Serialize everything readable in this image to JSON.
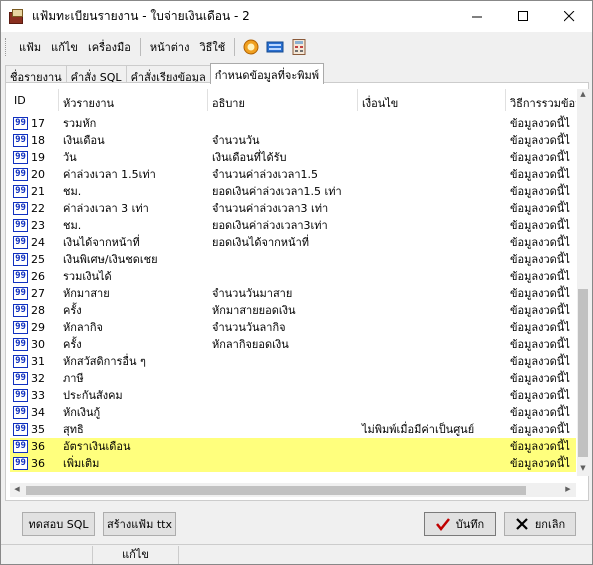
{
  "window": {
    "title": "แฟ้มทะเบียนรายงาน - ใบจ่ายเงินเดือน - 2"
  },
  "menu": {
    "items": [
      "แฟ้ม",
      "แก้ไข",
      "เครื่องมือ",
      "หน้าต่าง",
      "วิธีใช้"
    ]
  },
  "tabs": [
    "ชื่อรายงาน",
    "คำสั่ง SQL",
    "คำสั่งเรียงข้อมูล",
    "กำหนดข้อมูลที่จะพิมพ์"
  ],
  "grid": {
    "columns": [
      "ID",
      "หัวรายงาน",
      "อธิบาย",
      "เงื่อนไข",
      "วิธีการรวมข้อมูล"
    ],
    "rows": [
      {
        "badge": "99",
        "id": "17",
        "title": "รวมหัก",
        "desc": "",
        "cond": "",
        "sum": "ข้อมูลงวดนี้ไ",
        "hl": false
      },
      {
        "badge": "99",
        "id": "18",
        "title": "เงินเดือน",
        "desc": "จำนวนวัน",
        "cond": "",
        "sum": "ข้อมูลงวดนี้ไ",
        "hl": false
      },
      {
        "badge": "99",
        "id": "19",
        "title": "วัน",
        "desc": "เงินเดือนที่ได้รับ",
        "cond": "",
        "sum": "ข้อมูลงวดนี้ไ",
        "hl": false
      },
      {
        "badge": "99",
        "id": "20",
        "title": "ค่าล่วงเวลา 1.5เท่า",
        "desc": "จำนวนค่าล่วงเวลา1.5",
        "cond": "",
        "sum": "ข้อมูลงวดนี้ไ",
        "hl": false
      },
      {
        "badge": "99",
        "id": "21",
        "title": "ชม.",
        "desc": "ยอดเงินค่าล่วงเวลา1.5 เท่า",
        "cond": "",
        "sum": "ข้อมูลงวดนี้ไ",
        "hl": false
      },
      {
        "badge": "99",
        "id": "22",
        "title": "ค่าล่วงเวลา 3 เท่า",
        "desc": "จำนวนค่าล่วงเวลา3 เท่า",
        "cond": "",
        "sum": "ข้อมูลงวดนี้ไ",
        "hl": false
      },
      {
        "badge": "99",
        "id": "23",
        "title": "ชม.",
        "desc": "ยอดเงินค่าล่วงเวลา3เท่า",
        "cond": "",
        "sum": "ข้อมูลงวดนี้ไ",
        "hl": false
      },
      {
        "badge": "99",
        "id": "24",
        "title": "เงินได้จากหน้าที่",
        "desc": "ยอดเงินได้จากหน้าที่",
        "cond": "",
        "sum": "ข้อมูลงวดนี้ไ",
        "hl": false
      },
      {
        "badge": "99",
        "id": "25",
        "title": "เงินพิเศษ/เงินชดเชย",
        "desc": "",
        "cond": "",
        "sum": "ข้อมูลงวดนี้ไ",
        "hl": false
      },
      {
        "badge": "99",
        "id": "26",
        "title": "รวมเงินได้",
        "desc": "",
        "cond": "",
        "sum": "ข้อมูลงวดนี้ไ",
        "hl": false
      },
      {
        "badge": "99",
        "id": "27",
        "title": "หักมาสาย",
        "desc": "จำนวนวันมาสาย",
        "cond": "",
        "sum": "ข้อมูลงวดนี้ไ",
        "hl": false
      },
      {
        "badge": "99",
        "id": "28",
        "title": "ครั้ง",
        "desc": "หักมาสายยอดเงิน",
        "cond": "",
        "sum": "ข้อมูลงวดนี้ไ",
        "hl": false
      },
      {
        "badge": "99",
        "id": "29",
        "title": "หักลากิจ",
        "desc": "จำนวนวันลากิจ",
        "cond": "",
        "sum": "ข้อมูลงวดนี้ไ",
        "hl": false
      },
      {
        "badge": "99",
        "id": "30",
        "title": "ครั้ง",
        "desc": "หักลากิจยอดเงิน",
        "cond": "",
        "sum": "ข้อมูลงวดนี้ไ",
        "hl": false
      },
      {
        "badge": "99",
        "id": "31",
        "title": "หักสวัสดิการอื่น ๆ",
        "desc": "",
        "cond": "",
        "sum": "ข้อมูลงวดนี้ไ",
        "hl": false
      },
      {
        "badge": "99",
        "id": "32",
        "title": "ภาษี",
        "desc": "",
        "cond": "",
        "sum": "ข้อมูลงวดนี้ไ",
        "hl": false
      },
      {
        "badge": "99",
        "id": "33",
        "title": "ประกันสังคม",
        "desc": "",
        "cond": "",
        "sum": "ข้อมูลงวดนี้ไ",
        "hl": false
      },
      {
        "badge": "99",
        "id": "34",
        "title": "หักเงินกู้",
        "desc": "",
        "cond": "",
        "sum": "ข้อมูลงวดนี้ไ",
        "hl": false
      },
      {
        "badge": "99",
        "id": "35",
        "title": "สุทธิ",
        "desc": "",
        "cond": "ไม่พิมพ์เมื่อมีค่าเป็นศูนย์",
        "sum": "ข้อมูลงวดนี้ไ",
        "hl": false
      },
      {
        "badge": "99",
        "id": "36",
        "title": "อัตราเงินเดือน",
        "desc": "",
        "cond": "",
        "sum": "ข้อมูลงวดนี้ไ",
        "hl": true
      },
      {
        "badge": "99",
        "id": "36",
        "title": "เพิ่มเติม",
        "desc": "",
        "cond": "",
        "sum": "ข้อมูลงวดนี้ไ",
        "hl": true
      }
    ]
  },
  "buttons": {
    "test_sql": "ทดสอบ SQL",
    "create_ttx": "สร้างแฟ้ม ttx",
    "save": "บันทึก",
    "cancel": "ยกเลิก"
  },
  "status": {
    "mode": "แก้ไข"
  },
  "colors": {
    "highlight": "#ffff7d",
    "badge": "#1030c0",
    "save_check": "#c00000"
  }
}
